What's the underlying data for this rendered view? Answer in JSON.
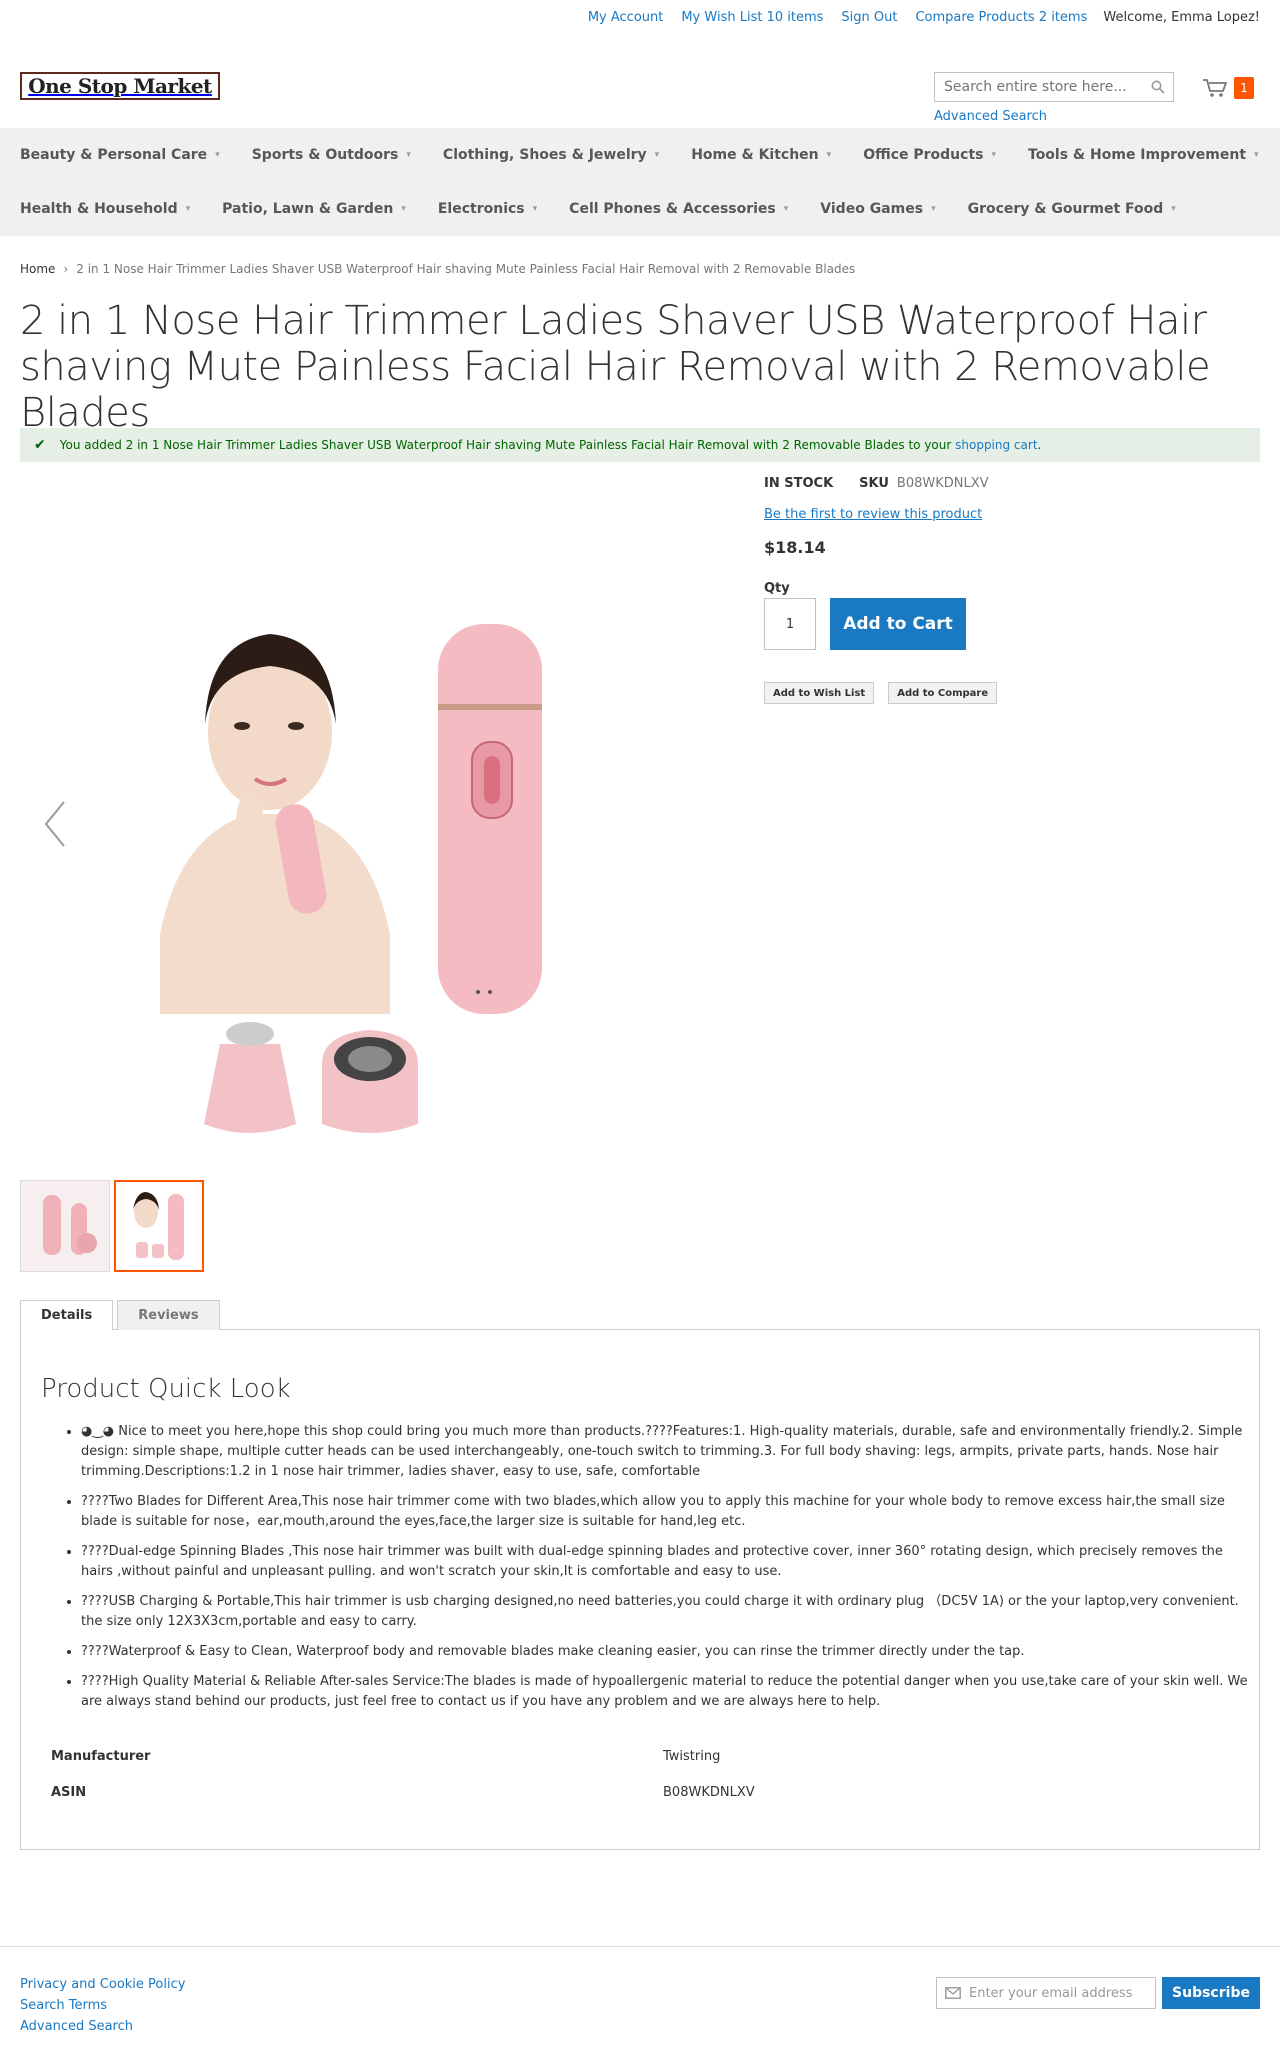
{
  "top_links": {
    "my_account": "My Account",
    "wish_list": "My Wish List 10 items",
    "sign_out": "Sign Out",
    "compare": "Compare Products 2 items",
    "welcome": "Welcome, Emma Lopez!"
  },
  "header": {
    "logo_text": "One Stop Market",
    "search_placeholder": "Search entire store here...",
    "advanced_search": "Advanced Search",
    "cart_count": "1"
  },
  "nav": {
    "row1": [
      {
        "label": "Beauty & Personal Care"
      },
      {
        "label": "Sports & Outdoors"
      },
      {
        "label": "Clothing, Shoes & Jewelry"
      },
      {
        "label": "Home & Kitchen"
      },
      {
        "label": "Office Products"
      },
      {
        "label": "Tools & Home Improvement"
      }
    ],
    "row2": [
      {
        "label": "Health & Household"
      },
      {
        "label": "Patio, Lawn & Garden"
      },
      {
        "label": "Electronics"
      },
      {
        "label": "Cell Phones & Accessories"
      },
      {
        "label": "Video Games"
      },
      {
        "label": "Grocery & Gourmet Food"
      }
    ]
  },
  "breadcrumb": {
    "home": "Home",
    "current": "2 in 1 Nose Hair Trimmer Ladies Shaver USB Waterproof Hair shaving Mute Painless Facial Hair Removal with 2 Removable Blades"
  },
  "product": {
    "title": "2 in 1 Nose Hair Trimmer Ladies Shaver USB Waterproof Hair shaving Mute Painless Facial Hair Removal with 2 Removable Blades",
    "stock": "IN STOCK",
    "sku_label": "SKU",
    "sku": "B08WKDNLXV",
    "review_link": "Be the first to review this product",
    "price": "$18.14",
    "qty_label": "Qty",
    "qty_value": "1",
    "add_to_cart": "Add to Cart",
    "add_to_wishlist": "Add to Wish List",
    "add_to_compare": "Add to Compare"
  },
  "message": {
    "prefix": "You added 2 in 1 Nose Hair Trimmer Ladies Shaver USB Waterproof Hair shaving Mute Painless Facial Hair Removal with 2 Removable Blades to your ",
    "link": "shopping cart",
    "suffix": "."
  },
  "tabs": {
    "details": "Details",
    "reviews": "Reviews"
  },
  "details": {
    "heading": "Product Quick Look",
    "features": [
      "◕‿◕ Nice to meet you here,hope this shop could bring you much more than products.????Features:1. High-quality materials, durable, safe and environmentally friendly.2. Simple design: simple shape, multiple cutter heads can be used interchangeably, one-touch switch to trimming.3. For full body shaving: legs, armpits, private parts, hands. Nose hair trimming.Descriptions:1.2 in 1 nose hair trimmer, ladies shaver, easy to use, safe, comfortable",
      "????Two Blades for Different Area,This nose hair trimmer come with two blades,which allow you to apply this machine for your whole body to remove excess hair,the small size blade is suitable for nose，ear,mouth,around the eyes,face,the larger size is suitable for hand,leg etc.",
      "????Dual-edge Spinning Blades ,This nose hair trimmer was built with dual-edge spinning blades and protective cover, inner 360° rotating design, which precisely removes the hairs ,without painful and unpleasant pulling. and won't scratch your skin,It is comfortable and easy to use.",
      "????USB Charging & Portable,This hair trimmer is usb charging designed,no need batteries,you could charge it with ordinary plug （DC5V 1A) or the your laptop,very convenient. the size only 12X3X3cm,portable and easy to carry.",
      "????Waterproof & Easy to Clean, Waterproof body and removable blades make cleaning easier, you can rinse the trimmer directly under the tap.",
      "????High Quality Material & Reliable After-sales Service:The blades is made of hypoallergenic material to reduce the potential danger when you use,take care of your skin well. We are always stand behind our products, just feel free to contact us if you have any problem and we are always here to help."
    ],
    "attributes": [
      {
        "key": "Manufacturer",
        "value": "Twistring"
      },
      {
        "key": "ASIN",
        "value": "B08WKDNLXV"
      }
    ]
  },
  "footer": {
    "privacy": "Privacy and Cookie Policy",
    "search_terms": "Search Terms",
    "advanced_search": "Advanced Search",
    "newsletter_placeholder": "Enter your email address",
    "subscribe": "Subscribe"
  },
  "colors": {
    "link": "#1979c3",
    "cart_badge": "#ff5501",
    "success_bg": "#e5efe5"
  }
}
